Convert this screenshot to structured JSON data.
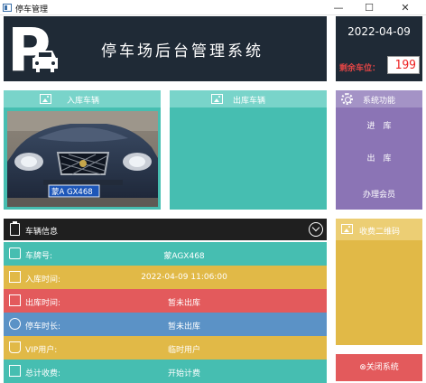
{
  "window": {
    "title": "停车管理",
    "controls": {
      "minimize": "—",
      "maximize": "☐",
      "close": "✕"
    }
  },
  "header": {
    "system_title": "停车场后台管理系统",
    "logo_letter": "P"
  },
  "info": {
    "date": "2022-04-09",
    "remaining_label": "剩余车位：",
    "remaining_count": "199"
  },
  "panels": {
    "entry_title": "入库车辆",
    "exit_title": "出库车辆",
    "entry_plate_text": "蒙A GX468"
  },
  "functions": {
    "title": "系统功能",
    "buttons": [
      "进　库",
      "出　库",
      "办理会员"
    ]
  },
  "vehicle_info": {
    "title": "车辆信息",
    "rows": [
      {
        "label": "车牌号:",
        "value": "蒙AGX468",
        "icon": "id-card-icon"
      },
      {
        "label": "入库时间:",
        "value": "2022-04-09 11:06:00",
        "icon": "enter-icon"
      },
      {
        "label": "出库时间:",
        "value": "暂未出库",
        "icon": "exit-icon"
      },
      {
        "label": "停车时长:",
        "value": "暂未出库",
        "icon": "clock-icon"
      },
      {
        "label": "VIP用户:",
        "value": "临时用户",
        "icon": "vip-basket-icon"
      },
      {
        "label": "总计收费:",
        "value": "开始计费",
        "icon": "money-icon"
      }
    ]
  },
  "qr": {
    "title": "收费二维码"
  },
  "close_button": {
    "icon": "⊗",
    "label": "关闭系统"
  },
  "colors": {
    "dark": "#1f2a36",
    "teal": "#46beb1",
    "teal_light": "#79d4ca",
    "purple": "#8b74b5",
    "yellow": "#e1b947",
    "red": "#e35a5c",
    "blue": "#5b92c6",
    "remaining_red": "#e04545"
  }
}
